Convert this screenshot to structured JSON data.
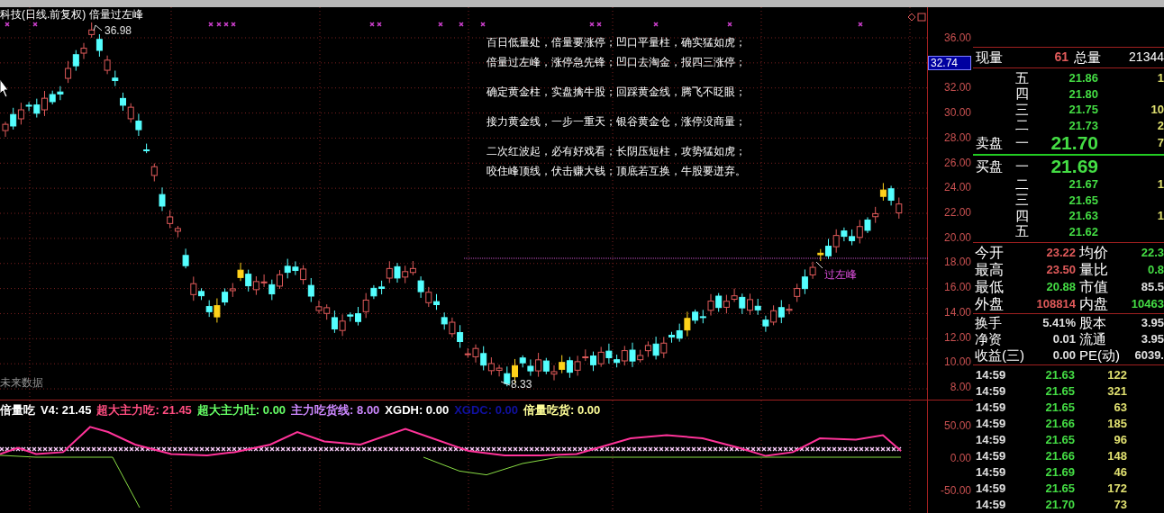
{
  "chart": {
    "title": "科技(日线.前复权) 倍量过左峰",
    "high_label": "36.98",
    "low_label": "8.33",
    "signal_label": "过左峰",
    "footer_note": "未来数据",
    "verse_groups": [
      [
        "百日低量处，倍量要涨停；凹口平量柱，确实猛如虎；",
        "倍量过左峰，涨停急先锋；凹口去淘金，报四三涨停；"
      ],
      [
        "确定黄金柱，实盘擒牛股；回踩黄金线，腾飞不眨眼；"
      ],
      [
        "接力黄金线，一步一重天；银谷黄金仓，涨停没商量；"
      ],
      [
        "二次红波起，必有好戏看；长阴压短柱，攻势猛如虎；",
        "咬住峰顶线，伏击赚大钱；顶底若互换，牛股要迸弃。"
      ]
    ],
    "price_axis": [
      {
        "kind": "tick",
        "text": "36.00"
      },
      {
        "kind": "cursor",
        "text": "32.74"
      },
      {
        "kind": "tick",
        "text": "32.00"
      },
      {
        "kind": "tick",
        "text": "30.00"
      },
      {
        "kind": "tick",
        "text": "28.00"
      },
      {
        "kind": "tick",
        "text": "26.00"
      },
      {
        "kind": "tick",
        "text": "24.00"
      },
      {
        "kind": "tick",
        "text": "22.00"
      },
      {
        "kind": "tick",
        "text": "20.00"
      },
      {
        "kind": "tick",
        "text": "18.00"
      },
      {
        "kind": "tick",
        "text": "16.00"
      },
      {
        "kind": "tick",
        "text": "14.00"
      },
      {
        "kind": "tick",
        "text": "12.00"
      },
      {
        "kind": "tick",
        "text": "10.00"
      },
      {
        "kind": "tick",
        "text": "8.00"
      }
    ]
  },
  "indicator": {
    "legend": [
      {
        "text": "倍量吃",
        "color": "#ffffff"
      },
      {
        "text": "V4: 21.45",
        "color": "#ffffff"
      },
      {
        "text": "超大主力吃: 21.45",
        "color": "#ff4d80"
      },
      {
        "text": "超大主力吐: 0.00",
        "color": "#66ff66"
      },
      {
        "text": "主力吃货线: 8.00",
        "color": "#cc88ff"
      },
      {
        "text": "XGDH: 0.00",
        "color": "#ffffff"
      },
      {
        "text": "XGDC: 0.00",
        "color": "#1010a0"
      },
      {
        "text": "倍量吃货: 0.00",
        "color": "#ffff99"
      }
    ],
    "axis": [
      "50.00",
      "0.00",
      "-50.00"
    ]
  },
  "quote": {
    "volume": {
      "label": "现量",
      "value": "61",
      "total_label": "总量",
      "total": "21344"
    },
    "sells": [
      {
        "level": "五",
        "price": "21.86",
        "volume": "1",
        "best": false
      },
      {
        "level": "四",
        "price": "21.80",
        "best": false
      },
      {
        "level": "三",
        "price": "21.75",
        "volume": "10",
        "best": false
      },
      {
        "level": "二",
        "price": "21.73",
        "volume": "2",
        "best": false
      },
      {
        "side_label": "卖盘",
        "level": "一",
        "price": "21.70",
        "volume": "7",
        "best": true
      }
    ],
    "buys": [
      {
        "side_label": "买盘",
        "level": "一",
        "price": "21.69",
        "best": true
      },
      {
        "level": "二",
        "price": "21.67",
        "volume": "1",
        "best": false
      },
      {
        "level": "三",
        "price": "21.65",
        "best": false
      },
      {
        "level": "四",
        "price": "21.63",
        "volume": "1",
        "best": false
      },
      {
        "level": "五",
        "price": "21.62",
        "best": false
      }
    ],
    "stats": [
      {
        "left": {
          "label": "今开",
          "value": "23.22",
          "color": "#e05a5a"
        },
        "right": {
          "label": "均价",
          "value": "22.3",
          "color": "#44dd44"
        }
      },
      {
        "left": {
          "label": "最高",
          "value": "23.50",
          "color": "#e05a5a"
        },
        "right": {
          "label": "量比",
          "value": "0.8",
          "color": "#44dd44"
        }
      },
      {
        "left": {
          "label": "最低",
          "value": "20.88",
          "color": "#44dd44"
        },
        "right": {
          "label": "市值",
          "value": "85.5",
          "color": "#e0e0e0"
        }
      },
      {
        "left": {
          "label": "外盘",
          "value": "108814",
          "color": "#e05a5a"
        },
        "right": {
          "label": "内盘",
          "value": "10463",
          "color": "#44dd44"
        }
      }
    ],
    "capital": [
      {
        "label": "换手",
        "value": "5.41%",
        "label2": "股本",
        "value2": "3.95"
      },
      {
        "label": "净资",
        "value": "0.01",
        "label2": "流通",
        "value2": "3.95"
      },
      {
        "label": "收益(三)",
        "value": "0.00",
        "label2": "PE(动)",
        "value2": "6039."
      }
    ],
    "ticks": [
      {
        "time": "14:59",
        "price": "21.63",
        "volume": "122"
      },
      {
        "time": "14:59",
        "price": "21.65",
        "volume": "321"
      },
      {
        "time": "14:59",
        "price": "21.65",
        "volume": "63"
      },
      {
        "time": "14:59",
        "price": "21.66",
        "volume": "185"
      },
      {
        "time": "14:59",
        "price": "21.65",
        "volume": "96"
      },
      {
        "time": "14:59",
        "price": "21.66",
        "volume": "148"
      },
      {
        "time": "14:59",
        "price": "21.69",
        "volume": "46"
      },
      {
        "time": "14:59",
        "price": "21.65",
        "volume": "172"
      },
      {
        "time": "14:59",
        "price": "21.70",
        "volume": "73"
      }
    ]
  }
}
